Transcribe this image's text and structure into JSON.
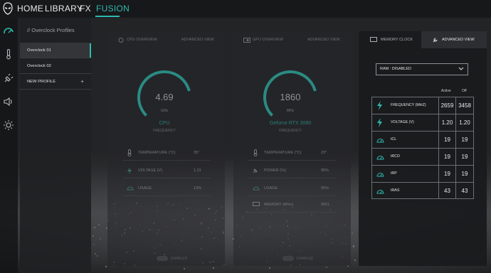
{
  "nav": {
    "tabs": [
      {
        "label": "HOME"
      },
      {
        "label": "LIBRARY"
      },
      {
        "label": "FX"
      },
      {
        "label": "FUSION"
      }
    ],
    "active": "FUSION"
  },
  "rail": {
    "icons": [
      "performance-gauge-icon",
      "thermometer-icon",
      "power-plug-icon",
      "speaker-icon",
      "sun-brightness-icon"
    ]
  },
  "profiles": {
    "title": "// Overclock Profiles",
    "items": [
      {
        "label": "Overclock 01"
      },
      {
        "label": "Overclock 02"
      },
      {
        "label": "NEW PROFILE"
      }
    ],
    "add_symbol": "+"
  },
  "cpu_card": {
    "tabs": [
      {
        "label": "CPU OVERVIEW"
      },
      {
        "label": "ADVANCED VIEW"
      }
    ],
    "gauge": {
      "value": "4.69",
      "unit": "GHz",
      "name": "CPU",
      "sub": "FREQUENCY",
      "fraction": 0.78
    },
    "stats": [
      {
        "label": "TEMPERATURE (°C)",
        "value": "35°",
        "icon": "thermometer-icon"
      },
      {
        "label": "VOLTAGE (V)",
        "value": "1.31",
        "icon": "lightning-icon"
      },
      {
        "label": "USAGE",
        "value": "13%",
        "icon": "gauge-icon"
      }
    ],
    "toggle_label": "ENABLED"
  },
  "gpu_card": {
    "tabs": [
      {
        "label": "GPU OVERVIEW"
      },
      {
        "label": "ADVANCED VIEW"
      }
    ],
    "gauge": {
      "value": "1860",
      "unit": "MHz",
      "name": "Geforce RTX 3080",
      "sub": "FREQUENCY",
      "fraction": 0.78
    },
    "stats": [
      {
        "label": "TEMPERATURE (°C)",
        "value": "23°",
        "icon": "thermometer-icon"
      },
      {
        "label": "POWER (%)",
        "value": "95%",
        "icon": "plug-icon"
      },
      {
        "label": "USAGE",
        "value": "95%",
        "icon": "gauge-icon"
      },
      {
        "label": "MEMORY (MHz)",
        "value": "9501",
        "icon": "memory-icon"
      }
    ],
    "toggle_label": "ENABLED"
  },
  "memory": {
    "tabs": [
      {
        "label": "MEMORY CLOCK"
      },
      {
        "label": "ADVANCED VIEW"
      }
    ],
    "active_tab": "ADVANCED VIEW",
    "dropdown": {
      "value": "RAM : DISABLED"
    },
    "col_active": "Active",
    "col_off": "Off",
    "rows": [
      {
        "label": "FREQUENCY (MHZ)",
        "active": "2659",
        "off": "3458",
        "icon": "lightning-icon"
      },
      {
        "label": "VOLTAGE (V)",
        "active": "1.20",
        "off": "1.20",
        "icon": "lightning-icon"
      },
      {
        "label": "tCL",
        "active": "19",
        "off": "19",
        "icon": "gauge-icon"
      },
      {
        "label": "tRCD",
        "active": "19",
        "off": "19",
        "icon": "gauge-icon"
      },
      {
        "label": "tRP",
        "active": "19",
        "off": "19",
        "icon": "gauge-icon"
      },
      {
        "label": "tRAS",
        "active": "43",
        "off": "43",
        "icon": "gauge-icon"
      }
    ]
  },
  "colors": {
    "accent": "#2fb9b0",
    "panel": "#1a1b1d",
    "text": "#e1e3e5"
  }
}
